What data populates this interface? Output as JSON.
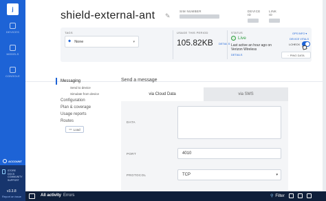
{
  "sidebar": {
    "logo": "j",
    "items": [
      {
        "label": "DEVICES",
        "icon": "devices-icon"
      },
      {
        "label": "MODELS",
        "icon": "models-icon"
      },
      {
        "label": "CONSOLE",
        "icon": "console-icon"
      }
    ],
    "account": "ACCOUNT",
    "store_links": [
      "STORE",
      "DOCS",
      "COMMUNITY",
      "SUPPORT"
    ],
    "version": "v3.3.8",
    "report": "Report an issue"
  },
  "header": {
    "title": "shield-external-ant",
    "sim_label": "SIM NUMBER",
    "device_label": "DEVICE ID",
    "link_label": "LINK ID",
    "tags_label": "TAGS",
    "tags_value": "None",
    "usage_label": "USAGE THIS PERIOD",
    "usage_value": "105.82KB",
    "usage_detail": "DETAILS",
    "status_label": "STATUS",
    "status_live": "Live",
    "status_text": "Last active an hour ago on Verizon Wireless",
    "status_details": "DETAILS",
    "gps_label": "GPS INFO",
    "vitals_label": "DEVICE VITALS",
    "lcheck": "LCHECK",
    "ping_label": "PING DATA"
  },
  "menu": {
    "items": [
      "Messaging",
      "Configuration",
      "Plan & coverage",
      "Usage reports",
      "Routes"
    ],
    "subitems": [
      "Send to device",
      "Simulate from device"
    ],
    "load": "Load"
  },
  "message": {
    "title": "Send a message",
    "tab_cloud": "via Cloud Data",
    "tab_sms": "via SMS",
    "data_label": "DATA",
    "port_label": "PORT",
    "port_value": "4010",
    "protocol_label": "PROTOCOL",
    "protocol_value": "TCP"
  },
  "bottombar": {
    "all_activity": "All activity",
    "errors": "Errors",
    "filter": "Filter"
  },
  "colors": {
    "accent": "#1d63d6",
    "live": "#2e9d3e",
    "bottombar": "#0f1f3a"
  }
}
